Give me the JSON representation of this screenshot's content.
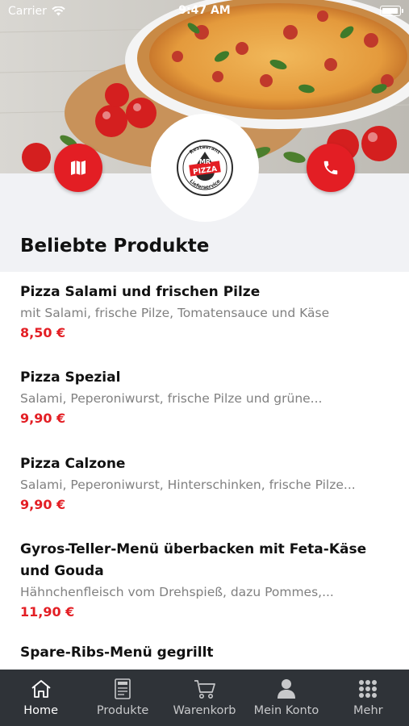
{
  "status_bar": {
    "carrier": "Carrier",
    "time": "9:47 AM"
  },
  "header": {
    "map_button_icon": "map-icon",
    "phone_button_icon": "phone-icon",
    "logo": {
      "top_text": "Restaurant",
      "main_text_1": "MR",
      "main_text_2": "PIZZA",
      "bottom_text": "Lieferservice"
    },
    "accent_color": "#e31e24"
  },
  "section": {
    "title": "Beliebte Produkte"
  },
  "products": [
    {
      "name": "Pizza Salami und frischen Pilze",
      "description": "mit Salami, frische Pilze, Tomatensauce und Käse",
      "price": "8,50 €"
    },
    {
      "name": "Pizza Spezial",
      "description": "Salami, Peperoniwurst, frische Pilze und grüne...",
      "price": "9,90 €"
    },
    {
      "name": "Pizza Calzone",
      "description": "Salami, Peperoniwurst, Hinterschinken, frische Pilze...",
      "price": "9,90 €"
    },
    {
      "name": "Gyros-Teller-Menü überbacken mit Feta-Käse und Gouda",
      "description": "Hähnchenfleisch vom Drehspieß, dazu Pommes,...",
      "price": "11,90 €"
    },
    {
      "name": "Spare-Ribs-Menü gegrillt",
      "description": "",
      "price": ""
    }
  ],
  "tabbar": {
    "tabs": [
      {
        "label": "Home",
        "icon": "home-icon",
        "active": true
      },
      {
        "label": "Produkte",
        "icon": "menu-card-icon",
        "active": false
      },
      {
        "label": "Warenkorb",
        "icon": "cart-icon",
        "active": false
      },
      {
        "label": "Mein Konto",
        "icon": "user-icon",
        "active": false
      },
      {
        "label": "Mehr",
        "icon": "grid-icon",
        "active": false
      }
    ]
  }
}
